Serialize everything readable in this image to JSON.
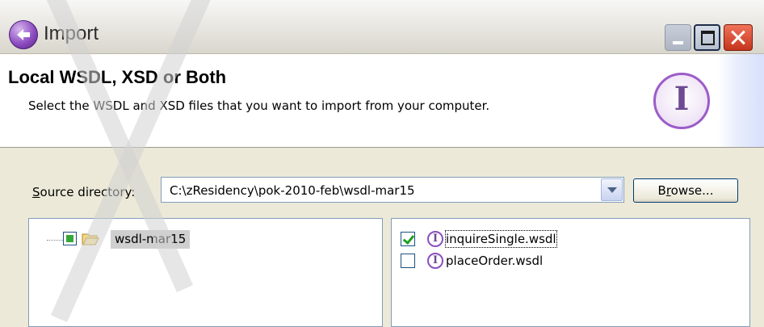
{
  "window": {
    "title": "Import",
    "icon": "import-wizard-icon",
    "controls": [
      "minimize",
      "maximize",
      "close"
    ]
  },
  "banner": {
    "title": "Local WSDL, XSD or Both",
    "description": "Select the WSDL and XSD files that you want to import from your computer.",
    "emblem_letter": "I"
  },
  "source": {
    "label_prefix": "",
    "label_mnemonic": "S",
    "label_rest": "ource directory:",
    "value": "C:\\zResidency\\pok-2010-feb\\wsdl-mar15",
    "browse_prefix": "B",
    "browse_mnemonic": "r",
    "browse_rest": "owse..."
  },
  "tree": {
    "folder": "wsdl-mar15",
    "checked_state": "partial"
  },
  "files": [
    {
      "name": "inquireSingle.wsdl",
      "checked": true,
      "focused": true,
      "icon_letter": "I"
    },
    {
      "name": "placeOrder.wsdl",
      "checked": false,
      "focused": false,
      "icon_letter": "I"
    }
  ],
  "colors": {
    "dialog_background": "#ece9d8",
    "close_button": "#c4351c",
    "accent_purple": "#8a4fc0",
    "check_green": "#21a121"
  }
}
